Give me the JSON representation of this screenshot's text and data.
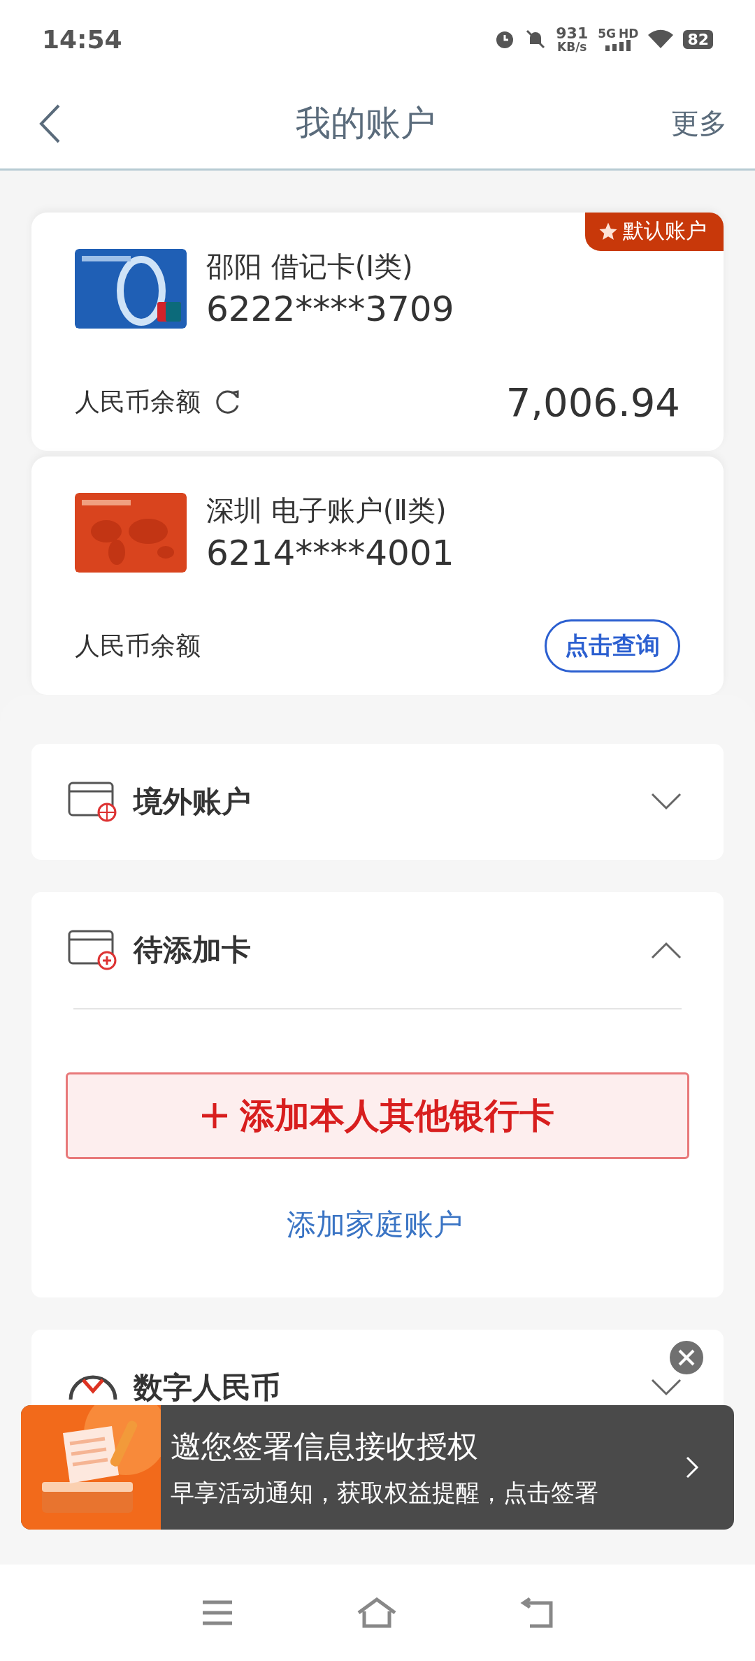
{
  "status_bar": {
    "time": "14:54",
    "speed": "931",
    "speed_unit": "KB/s",
    "network": "5G",
    "network_extra": "HD",
    "battery": "82"
  },
  "header": {
    "title": "我的账户",
    "more": "更多"
  },
  "accounts": [
    {
      "name": "邵阳 借记卡(Ⅰ类)",
      "number": "6222****3709",
      "balance_label": "人民币余额",
      "balance": "7,006.94",
      "badge": "默认账户"
    },
    {
      "name": "深圳 电子账户(Ⅱ类)",
      "number": "6214****4001",
      "balance_label": "人民币余额",
      "query_button": "点击查询"
    }
  ],
  "sections": [
    {
      "title": "境外账户",
      "expanded": false
    },
    {
      "title": "待添加卡",
      "expanded": true,
      "add_button": "添加本人其他银行卡",
      "link": "添加家庭账户"
    },
    {
      "title": "数字人民币",
      "expanded": false
    }
  ],
  "banner": {
    "title": "邀您签署信息接收授权",
    "subtitle": "早享活动通知，获取权益提醒，点击签署"
  }
}
